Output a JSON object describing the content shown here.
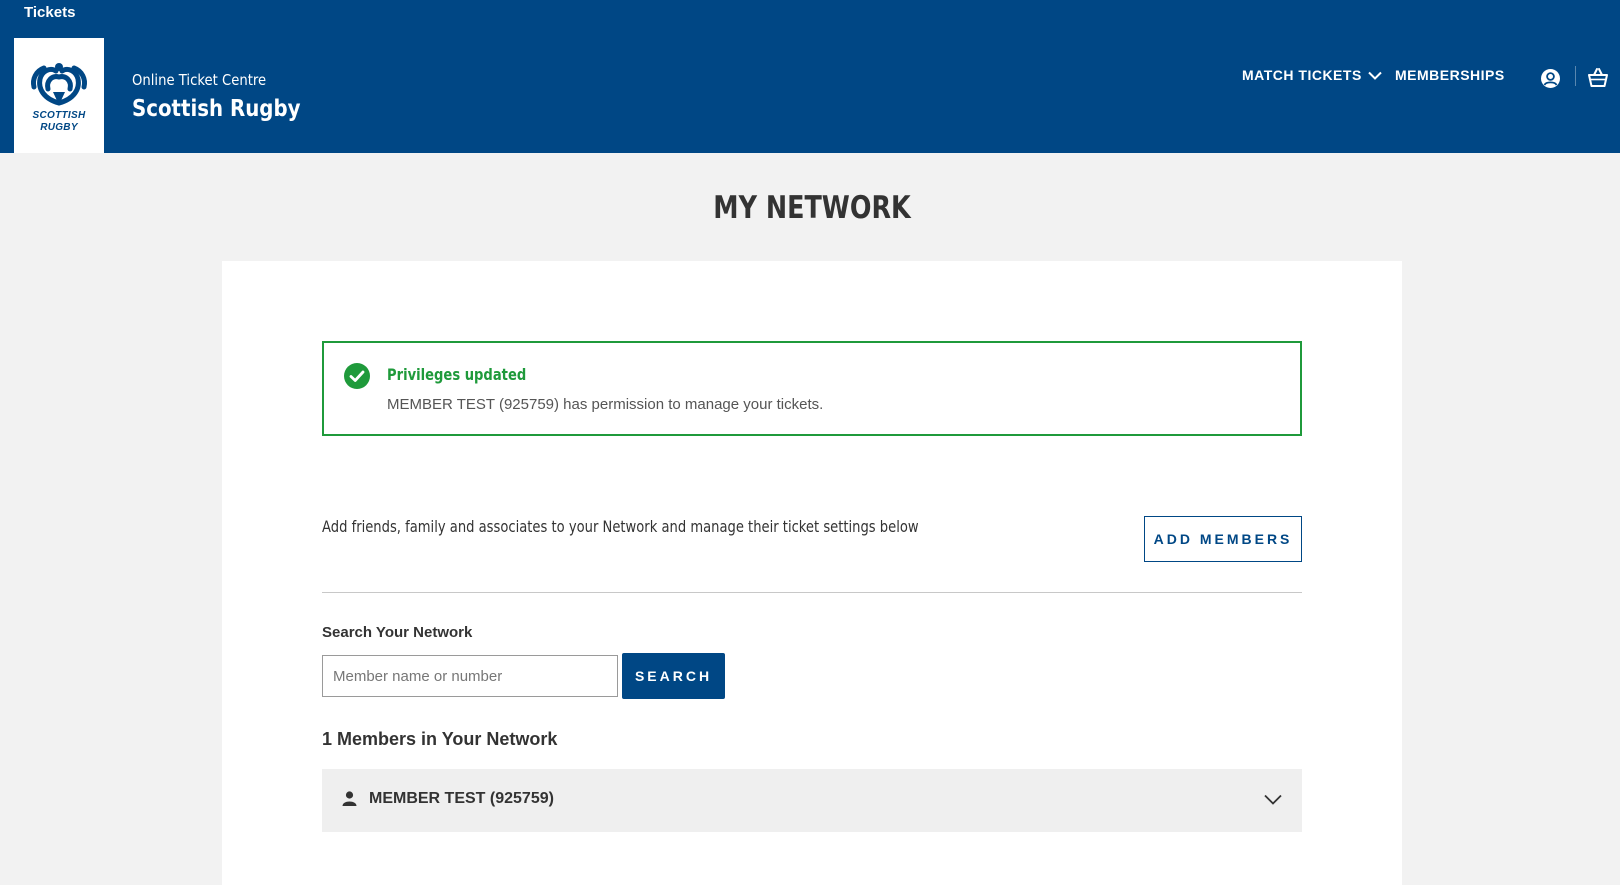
{
  "header": {
    "site_label": "Tickets",
    "logo_line1": "SCOTTISH",
    "logo_line2": "RUGBY",
    "brand_subtitle": "Online Ticket Centre",
    "brand_title": "Scottish Rugby",
    "nav": [
      {
        "label": "MATCH TICKETS",
        "icon": "chevron-down-icon"
      },
      {
        "label": "MEMBERSHIPS"
      }
    ],
    "icons": [
      "user-account-icon",
      "basket-icon"
    ],
    "bg_color": "#004785"
  },
  "page": {
    "title": "MY NETWORK"
  },
  "alert": {
    "icon": "check-circle-icon",
    "title": "Privileges updated",
    "message": "MEMBER TEST (925759) has permission to manage your tickets.",
    "color": "#1f9a3b"
  },
  "intro": {
    "text": "Add friends, family and associates to your Network and manage their ticket settings below",
    "add_button": "ADD MEMBERS"
  },
  "search": {
    "label": "Search Your Network",
    "placeholder": "Member name or number",
    "value": "",
    "button": "SEARCH"
  },
  "members": {
    "count_text": "1 Members in Your Network",
    "items": [
      {
        "name": "MEMBER TEST (925759)",
        "icon": "person-icon",
        "toggle_icon": "chevron-down-icon"
      }
    ]
  }
}
